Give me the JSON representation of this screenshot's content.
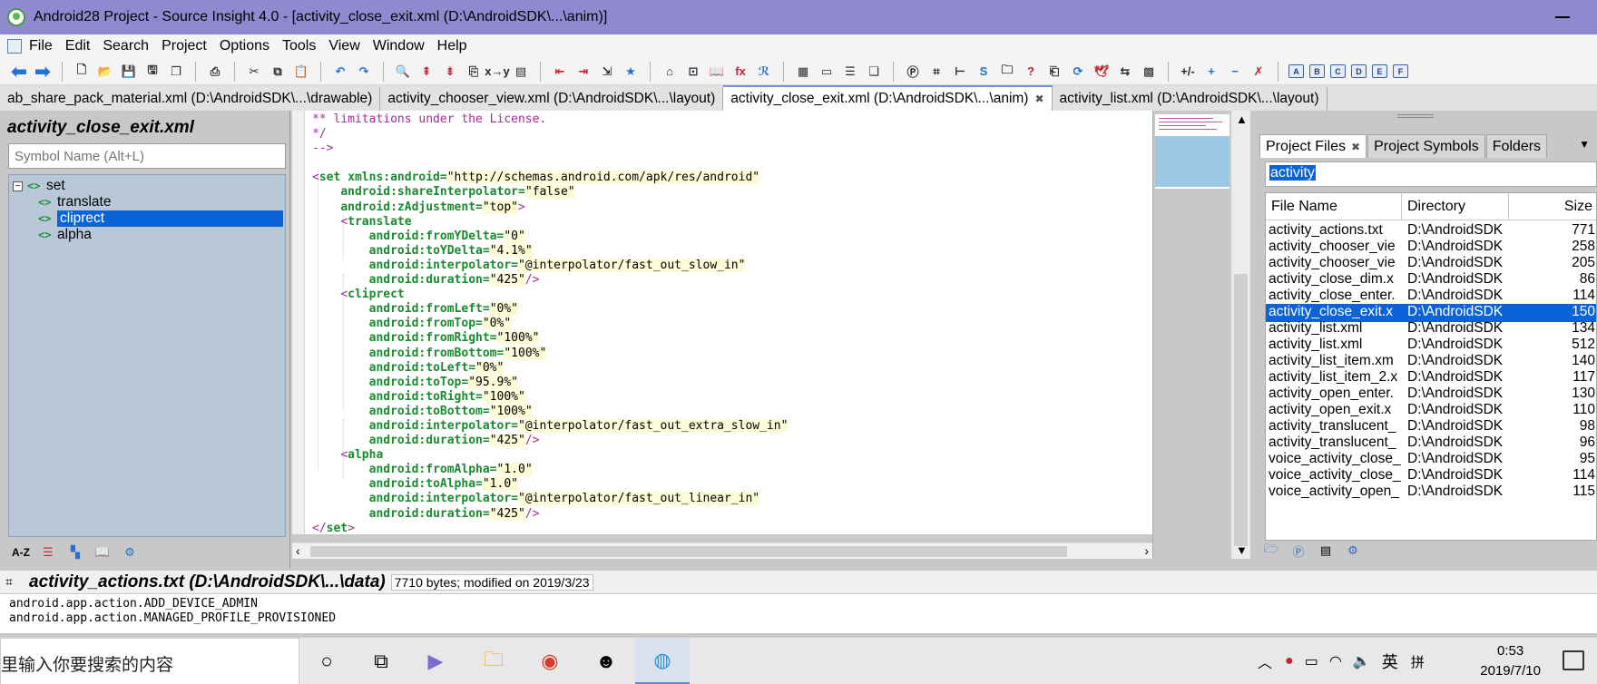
{
  "window": {
    "title": "Android28 Project - Source Insight 4.0 - [activity_close_exit.xml (D:\\AndroidSDK\\...\\anim)]"
  },
  "menu": [
    "File",
    "Edit",
    "Search",
    "Project",
    "Options",
    "Tools",
    "View",
    "Window",
    "Help"
  ],
  "tabs": [
    {
      "label": "ab_share_pack_material.xml (D:\\AndroidSDK\\...\\drawable)",
      "active": false
    },
    {
      "label": "activity_chooser_view.xml (D:\\AndroidSDK\\...\\layout)",
      "active": false
    },
    {
      "label": "activity_close_exit.xml (D:\\AndroidSDK\\...\\anim)",
      "active": true,
      "close": "✖"
    },
    {
      "label": "activity_list.xml (D:\\AndroidSDK\\...\\layout)",
      "active": false
    }
  ],
  "symbol_panel": {
    "file_title": "activity_close_exit.xml",
    "search_placeholder": "Symbol Name (Alt+L)",
    "tree": [
      {
        "label": "set",
        "level": 0,
        "expander": "−"
      },
      {
        "label": "translate",
        "level": 1
      },
      {
        "label": "cliprect",
        "level": 1,
        "selected": true
      },
      {
        "label": "alpha",
        "level": 1
      }
    ],
    "bottom_tools": [
      "A-Z",
      "list-icon",
      "color-icon",
      "book-icon",
      "gear-icon"
    ]
  },
  "editor": {
    "lines": [
      [
        {
          "t": "c-comment",
          "v": "** limitations under the License."
        }
      ],
      [
        {
          "t": "c-comment",
          "v": "*/"
        }
      ],
      [
        {
          "t": "c-comment",
          "v": "-->"
        }
      ],
      [
        {
          "t": "",
          "v": ""
        }
      ],
      [
        {
          "t": "c-punct",
          "v": "<"
        },
        {
          "t": "c-tag",
          "v": "set "
        },
        {
          "t": "c-attr",
          "v": "xmlns:android="
        },
        {
          "t": "c-val",
          "v": "\"http://schemas.android.com/apk/res/android\""
        }
      ],
      [
        {
          "t": "",
          "v": "    "
        },
        {
          "t": "c-attr",
          "v": "android:shareInterpolator="
        },
        {
          "t": "c-val",
          "v": "\"false\""
        }
      ],
      [
        {
          "t": "",
          "v": "    "
        },
        {
          "t": "c-attr",
          "v": "android:zAdjustment="
        },
        {
          "t": "c-val",
          "v": "\"top\""
        },
        {
          "t": "c-punct",
          "v": ">"
        }
      ],
      [
        {
          "t": "",
          "v": "    "
        },
        {
          "t": "c-punct",
          "v": "<"
        },
        {
          "t": "c-tag",
          "v": "translate"
        }
      ],
      [
        {
          "t": "",
          "v": "        "
        },
        {
          "t": "c-attr",
          "v": "android:fromYDelta="
        },
        {
          "t": "c-val",
          "v": "\"0\""
        }
      ],
      [
        {
          "t": "",
          "v": "        "
        },
        {
          "t": "c-attr",
          "v": "android:toYDelta="
        },
        {
          "t": "c-val",
          "v": "\"4.1%\""
        }
      ],
      [
        {
          "t": "",
          "v": "        "
        },
        {
          "t": "c-attr",
          "v": "android:interpolator="
        },
        {
          "t": "c-val",
          "v": "\"@interpolator/fast_out_slow_in\""
        }
      ],
      [
        {
          "t": "",
          "v": "        "
        },
        {
          "t": "c-attr",
          "v": "android:duration="
        },
        {
          "t": "c-val",
          "v": "\"425\""
        },
        {
          "t": "c-punct",
          "v": "/>"
        }
      ],
      [
        {
          "t": "",
          "v": "    "
        },
        {
          "t": "c-punct",
          "v": "<"
        },
        {
          "t": "c-tag",
          "v": "cliprect"
        }
      ],
      [
        {
          "t": "",
          "v": "        "
        },
        {
          "t": "c-attr",
          "v": "android:fromLeft="
        },
        {
          "t": "c-val",
          "v": "\"0%\""
        }
      ],
      [
        {
          "t": "",
          "v": "        "
        },
        {
          "t": "c-attr",
          "v": "android:fromTop="
        },
        {
          "t": "c-val",
          "v": "\"0%\""
        }
      ],
      [
        {
          "t": "",
          "v": "        "
        },
        {
          "t": "c-attr",
          "v": "android:fromRight="
        },
        {
          "t": "c-val",
          "v": "\"100%\""
        }
      ],
      [
        {
          "t": "",
          "v": "        "
        },
        {
          "t": "c-attr",
          "v": "android:fromBottom="
        },
        {
          "t": "c-val",
          "v": "\"100%\""
        }
      ],
      [
        {
          "t": "",
          "v": "        "
        },
        {
          "t": "c-attr",
          "v": "android:toLeft="
        },
        {
          "t": "c-val",
          "v": "\"0%\""
        }
      ],
      [
        {
          "t": "",
          "v": "        "
        },
        {
          "t": "c-attr",
          "v": "android:toTop="
        },
        {
          "t": "c-val",
          "v": "\"95.9%\""
        }
      ],
      [
        {
          "t": "",
          "v": "        "
        },
        {
          "t": "c-attr",
          "v": "android:toRight="
        },
        {
          "t": "c-val",
          "v": "\"100%\""
        }
      ],
      [
        {
          "t": "",
          "v": "        "
        },
        {
          "t": "c-attr",
          "v": "android:toBottom="
        },
        {
          "t": "c-val",
          "v": "\"100%\""
        }
      ],
      [
        {
          "t": "",
          "v": "        "
        },
        {
          "t": "c-attr",
          "v": "android:interpolator="
        },
        {
          "t": "c-val",
          "v": "\"@interpolator/fast_out_extra_slow_in\""
        }
      ],
      [
        {
          "t": "",
          "v": "        "
        },
        {
          "t": "c-attr",
          "v": "android:duration="
        },
        {
          "t": "c-val",
          "v": "\"425\""
        },
        {
          "t": "c-punct",
          "v": "/>"
        }
      ],
      [
        {
          "t": "",
          "v": "    "
        },
        {
          "t": "c-punct",
          "v": "<"
        },
        {
          "t": "c-tag",
          "v": "alpha"
        }
      ],
      [
        {
          "t": "",
          "v": "        "
        },
        {
          "t": "c-attr",
          "v": "android:fromAlpha="
        },
        {
          "t": "c-val",
          "v": "\"1.0\""
        }
      ],
      [
        {
          "t": "",
          "v": "        "
        },
        {
          "t": "c-attr",
          "v": "android:toAlpha="
        },
        {
          "t": "c-val",
          "v": "\"1.0\""
        }
      ],
      [
        {
          "t": "",
          "v": "        "
        },
        {
          "t": "c-attr",
          "v": "android:interpolator="
        },
        {
          "t": "c-val",
          "v": "\"@interpolator/fast_out_linear_in\""
        }
      ],
      [
        {
          "t": "",
          "v": "        "
        },
        {
          "t": "c-attr",
          "v": "android:duration="
        },
        {
          "t": "c-val",
          "v": "\"425\""
        },
        {
          "t": "c-punct",
          "v": "/>"
        }
      ],
      [
        {
          "t": "c-punct",
          "v": "</"
        },
        {
          "t": "c-tag",
          "v": "set"
        },
        {
          "t": "c-punct",
          "v": ">"
        }
      ]
    ]
  },
  "project_panel": {
    "tabs": [
      {
        "label": "Project Files",
        "active": true,
        "close": "✖"
      },
      {
        "label": "Project Symbols",
        "active": false
      },
      {
        "label": "Folders",
        "active": false
      }
    ],
    "filter": "activity",
    "columns": [
      "File Name",
      "Directory",
      "Size"
    ],
    "files": [
      {
        "name": "activity_actions.txt",
        "dir": "D:\\AndroidSDK",
        "size": "771"
      },
      {
        "name": "activity_chooser_vie",
        "dir": "D:\\AndroidSDK",
        "size": "258"
      },
      {
        "name": "activity_chooser_vie",
        "dir": "D:\\AndroidSDK",
        "size": "205"
      },
      {
        "name": "activity_close_dim.x",
        "dir": "D:\\AndroidSDK",
        "size": "86"
      },
      {
        "name": "activity_close_enter.",
        "dir": "D:\\AndroidSDK",
        "size": "114"
      },
      {
        "name": "activity_close_exit.x",
        "dir": "D:\\AndroidSDK",
        "size": "150",
        "selected": true
      },
      {
        "name": "activity_list.xml",
        "dir": "D:\\AndroidSDK",
        "size": "134"
      },
      {
        "name": "activity_list.xml",
        "dir": "D:\\AndroidSDK",
        "size": "512"
      },
      {
        "name": "activity_list_item.xm",
        "dir": "D:\\AndroidSDK",
        "size": "140"
      },
      {
        "name": "activity_list_item_2.x",
        "dir": "D:\\AndroidSDK",
        "size": "117"
      },
      {
        "name": "activity_open_enter.",
        "dir": "D:\\AndroidSDK",
        "size": "130"
      },
      {
        "name": "activity_open_exit.x",
        "dir": "D:\\AndroidSDK",
        "size": "110"
      },
      {
        "name": "activity_translucent_",
        "dir": "D:\\AndroidSDK",
        "size": "98"
      },
      {
        "name": "activity_translucent_",
        "dir": "D:\\AndroidSDK",
        "size": "96"
      },
      {
        "name": "voice_activity_close_",
        "dir": "D:\\AndroidSDK",
        "size": "95"
      },
      {
        "name": "voice_activity_close_",
        "dir": "D:\\AndroidSDK",
        "size": "114"
      },
      {
        "name": "voice_activity_open_",
        "dir": "D:\\AndroidSDK",
        "size": "115"
      }
    ]
  },
  "status": {
    "file": "activity_actions.txt (D:\\AndroidSDK\\...\\data)",
    "info": "7710 bytes; modified on 2019/3/23"
  },
  "context_window": {
    "text": "android.app.action.ADD_DEVICE_ADMIN\nandroid.app.action.MANAGED_PROFILE_PROVISIONED"
  },
  "taskbar": {
    "search": "里输入你要搜索的内容",
    "ime": "英",
    "ime_mode": "拼",
    "time": "0:53",
    "date": "2019/7/10"
  },
  "colors": {
    "titlebar": "#8f89cf",
    "selection": "#0a64d8",
    "tree_bg": "#b9c8d8",
    "tag_green": "#1a8a2e",
    "comment_purple": "#a52a9a"
  }
}
